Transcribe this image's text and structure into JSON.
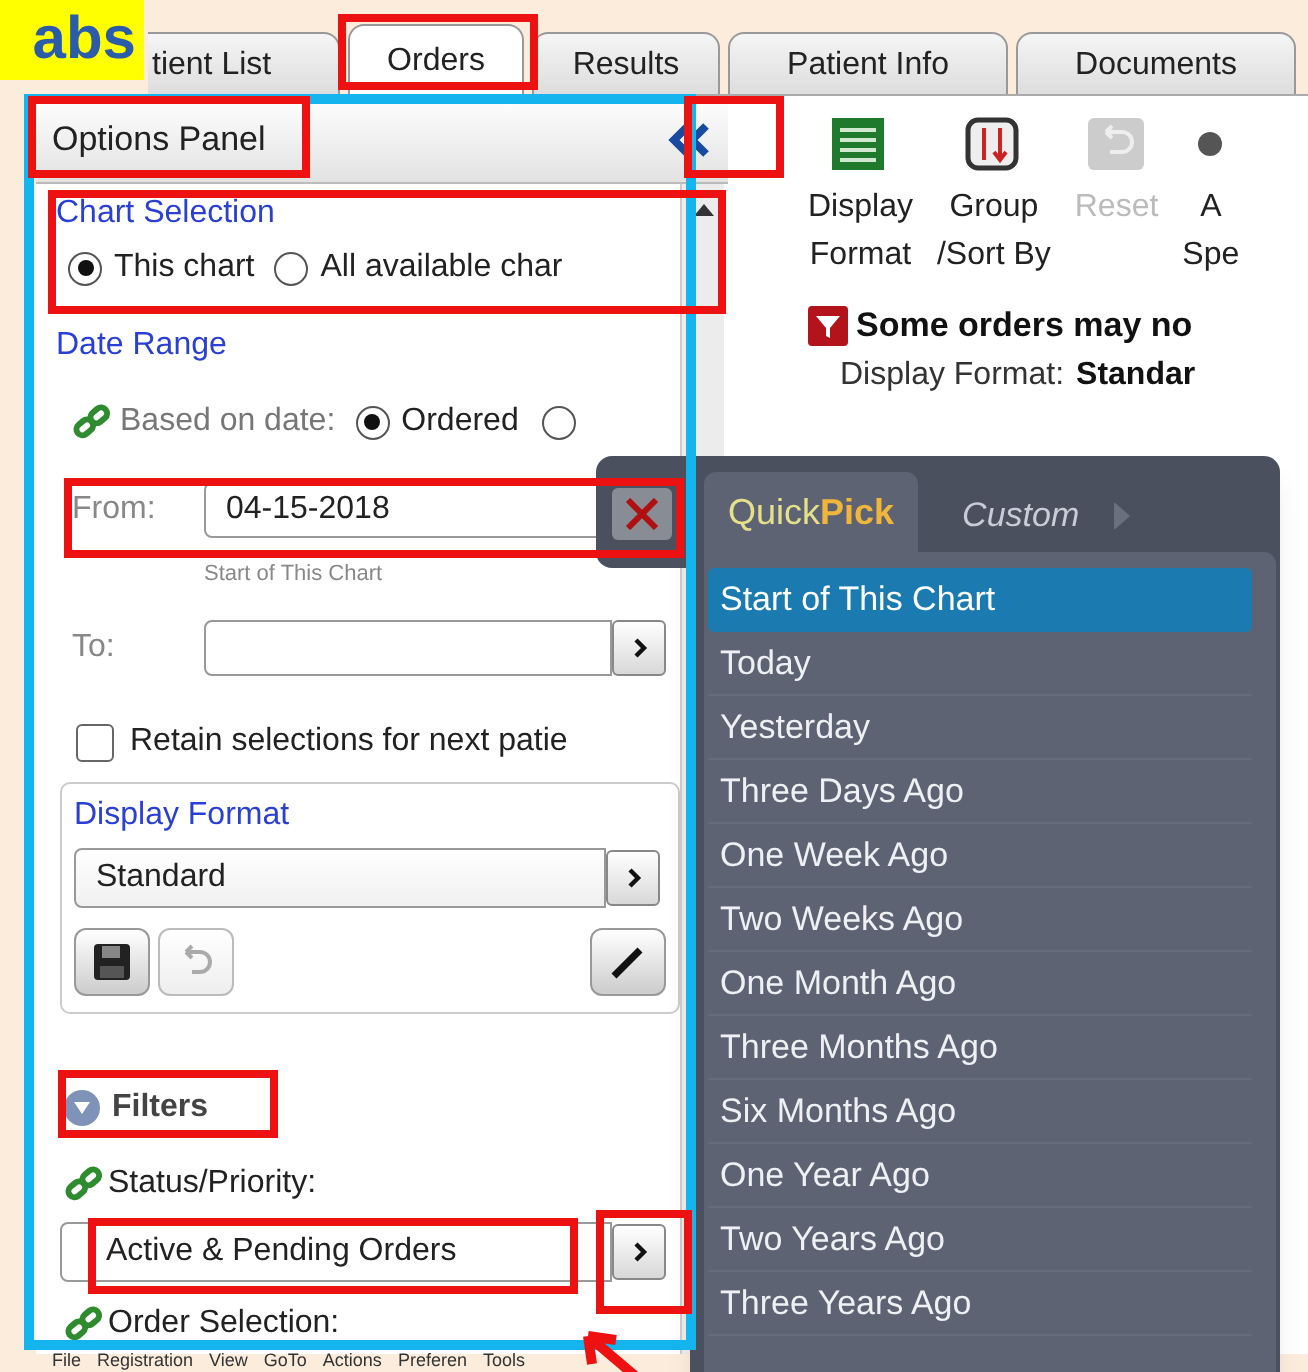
{
  "callout": {
    "text": "abs"
  },
  "tabs": [
    {
      "label": "tient List",
      "selected": false
    },
    {
      "label": "Orders",
      "selected": true
    },
    {
      "label": "Results",
      "selected": false
    },
    {
      "label": "Patient Info",
      "selected": false
    },
    {
      "label": "Documents",
      "selected": false
    }
  ],
  "options_panel": {
    "title": "Options Panel",
    "chart_selection": {
      "heading": "Chart Selection",
      "options": [
        {
          "label": "This chart",
          "selected": true
        },
        {
          "label": "All available char",
          "selected": false
        }
      ]
    },
    "date_range": {
      "heading": "Date Range",
      "based_on_label": "Based on date:",
      "options": [
        {
          "label": "Ordered",
          "selected": true
        },
        {
          "selected": false
        }
      ]
    },
    "from": {
      "label": "From:",
      "value": "04-15-2018",
      "hint": "Start of This Chart"
    },
    "to": {
      "label": "To:"
    },
    "retain": {
      "label": "Retain selections for next patie",
      "checked": false
    },
    "display_format": {
      "heading": "Display Format",
      "value": "Standard"
    },
    "filters": {
      "heading": "Filters",
      "expanded": true,
      "status_label": "Status/Priority:",
      "status_value": "Active & Pending Orders",
      "order_selection_label": "Order Selection:"
    }
  },
  "toolbar": [
    {
      "kind": "format",
      "lines": [
        "Display",
        "Format"
      ],
      "disabled": false
    },
    {
      "kind": "sort",
      "lines": [
        "Group",
        "/Sort By"
      ],
      "disabled": false
    },
    {
      "kind": "reset",
      "lines": [
        "Reset"
      ],
      "disabled": true
    },
    {
      "kind": "other",
      "lines": [
        "A",
        "Spe"
      ],
      "disabled": false
    }
  ],
  "notice": {
    "text": "Some orders may no",
    "format_label": "Display Format:",
    "format_value": "Standar"
  },
  "quickpick": {
    "tabs": [
      {
        "label_start": "Quick",
        "label_end": "Pick",
        "selected": true
      },
      {
        "label_start": "Custom",
        "selected": false
      }
    ],
    "items": [
      {
        "label": "Start of This Chart",
        "selected": true
      },
      {
        "label": "Today",
        "selected": false
      },
      {
        "label": "Yesterday",
        "selected": false
      },
      {
        "label": "Three Days Ago",
        "selected": false
      },
      {
        "label": "One Week Ago",
        "selected": false
      },
      {
        "label": "Two Weeks Ago",
        "selected": false
      },
      {
        "label": "One Month Ago",
        "selected": false
      },
      {
        "label": "Three Months Ago",
        "selected": false
      },
      {
        "label": "Six Months Ago",
        "selected": false
      },
      {
        "label": "One Year Ago",
        "selected": false
      },
      {
        "label": "Two Years Ago",
        "selected": false
      },
      {
        "label": "Three Years Ago",
        "selected": false
      }
    ]
  },
  "menu_bar": [
    "File",
    "Registration",
    "View",
    "GoTo",
    "Actions",
    "Preferen",
    "Tools"
  ]
}
